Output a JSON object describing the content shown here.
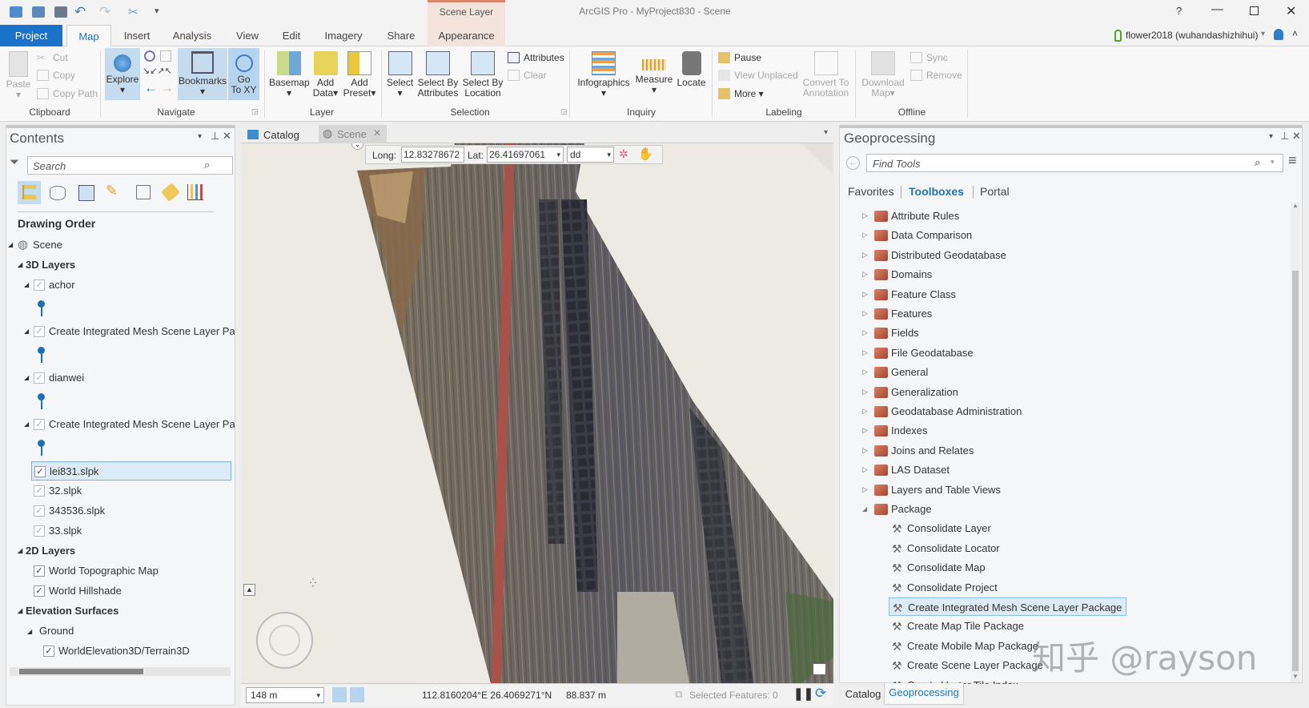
{
  "app": {
    "title": "ArcGIS Pro - MyProject830 - Scene",
    "context_tab_group": "Scene Layer",
    "user": "flower2018 (wuhandashizhihui)",
    "help": "?"
  },
  "tabs": [
    "Project",
    "Map",
    "Insert",
    "Analysis",
    "View",
    "Edit",
    "Imagery",
    "Share",
    "Appearance"
  ],
  "ribbon": {
    "clipboard": {
      "label": "Clipboard",
      "paste": "Paste",
      "cut": "Cut",
      "copy": "Copy",
      "copy_path": "Copy Path"
    },
    "navigate": {
      "label": "Navigate",
      "explore": "Explore",
      "bookmarks": "Bookmarks",
      "goto1": "Go",
      "goto2": "To XY"
    },
    "layer": {
      "label": "Layer",
      "basemap": "Basemap",
      "add_data1": "Add",
      "add_data2": "Data",
      "add_preset1": "Add",
      "add_preset2": "Preset"
    },
    "selection": {
      "label": "Selection",
      "select": "Select",
      "sba1": "Select By",
      "sba2": "Attributes",
      "sbl1": "Select By",
      "sbl2": "Location",
      "attributes": "Attributes",
      "clear": "Clear"
    },
    "inquiry": {
      "label": "Inquiry",
      "infographics": "Infographics",
      "measure": "Measure",
      "locate": "Locate"
    },
    "labeling": {
      "label": "Labeling",
      "pause": "Pause",
      "view_unplaced": "View Unplaced",
      "more": "More",
      "convert1": "Convert To",
      "convert2": "Annotation"
    },
    "offline": {
      "label": "Offline",
      "download1": "Download",
      "download2": "Map",
      "sync": "Sync",
      "remove": "Remove"
    }
  },
  "contents": {
    "title": "Contents",
    "search_placeholder": "Search",
    "heading": "Drawing Order",
    "rows": [
      {
        "kind": "group",
        "label": "Scene",
        "indent": 0
      },
      {
        "kind": "bold",
        "label": "3D Layers",
        "indent": 1
      },
      {
        "kind": "layer",
        "label": "achor",
        "checked": true,
        "light": true,
        "expand": true
      },
      {
        "kind": "pin"
      },
      {
        "kind": "layer",
        "label": "Create Integrated Mesh Scene Layer Pa",
        "checked": true,
        "light": true,
        "expand": true
      },
      {
        "kind": "pin"
      },
      {
        "kind": "layer",
        "label": "dianwei",
        "checked": true,
        "light": true,
        "expand": true
      },
      {
        "kind": "pin"
      },
      {
        "kind": "layer",
        "label": "Create Integrated Mesh Scene Layer Pa",
        "checked": true,
        "light": true,
        "expand": true
      },
      {
        "kind": "pin"
      },
      {
        "kind": "layer",
        "label": "lei831.slpk",
        "checked": true,
        "light": false,
        "selected": true
      },
      {
        "kind": "layer",
        "label": "32.slpk",
        "checked": true,
        "light": true
      },
      {
        "kind": "layer",
        "label": "343536.slpk",
        "checked": true,
        "light": true
      },
      {
        "kind": "layer",
        "label": "33.slpk",
        "checked": true,
        "light": true
      },
      {
        "kind": "bold",
        "label": "2D Layers",
        "indent": 1
      },
      {
        "kind": "layer",
        "label": "World Topographic Map",
        "checked": true,
        "light": false
      },
      {
        "kind": "layer",
        "label": "World Hillshade",
        "checked": true,
        "light": false
      },
      {
        "kind": "bold",
        "label": "Elevation Surfaces",
        "indent": 1
      },
      {
        "kind": "sub",
        "label": "Ground"
      },
      {
        "kind": "deep",
        "label": "WorldElevation3D/Terrain3D",
        "checked": true
      }
    ]
  },
  "view_tabs": {
    "catalog": "Catalog",
    "scene": "Scene"
  },
  "coords": {
    "long_label": "Long:",
    "long": "12.83278672",
    "lat_label": "Lat:",
    "lat": "26.41697061",
    "format": "dd"
  },
  "status": {
    "scale": "148 m",
    "location": "112.8160204°E 26.4069271°N",
    "elevation": "88.837 m",
    "selected": "Selected Features: 0"
  },
  "geoprocessing": {
    "title": "Geoprocessing",
    "search_placeholder": "Find Tools",
    "nav": [
      "Favorites",
      "Toolboxes",
      "Portal"
    ],
    "active_nav": 1,
    "toolboxes": [
      "Attribute Rules",
      "Data Comparison",
      "Distributed Geodatabase",
      "Domains",
      "Feature Class",
      "Features",
      "Fields",
      "File Geodatabase",
      "General",
      "Generalization",
      "Geodatabase Administration",
      "Indexes",
      "Joins and Relates",
      "LAS Dataset",
      "Layers and Table Views",
      "Package"
    ],
    "tools": [
      "Consolidate Layer",
      "Consolidate Locator",
      "Consolidate Map",
      "Consolidate Project",
      "Create Integrated Mesh Scene Layer Package",
      "Create Map Tile Package",
      "Create Mobile Map Package",
      "Create Scene Layer Package",
      "Create Vector Tile Index"
    ],
    "selected_tool": 4
  },
  "bottom_tabs": [
    "Catalog",
    "Geoprocessing"
  ],
  "watermark": "知乎 @rayson",
  "colors": {
    "accent": "#1a75bb",
    "project_tab": "#1a73c9",
    "selection": "#dcebf7",
    "context": "#f2e4dc"
  }
}
